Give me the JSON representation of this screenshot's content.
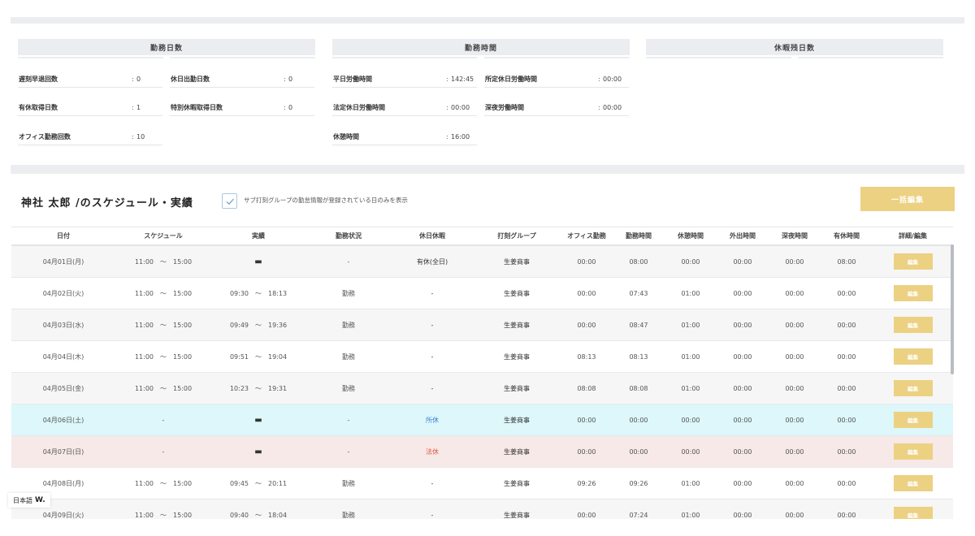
{
  "summary": {
    "work_days": {
      "title": "勤務日数",
      "items": [
        {
          "label": "遅刻早退回数",
          "value": "0"
        },
        {
          "label": "休日出勤日数",
          "value": "0"
        },
        {
          "label": "有休取得日数",
          "value": "1"
        },
        {
          "label": "特別休暇取得日数",
          "value": "0"
        },
        {
          "label": "オフィス勤務回数",
          "value": "10"
        }
      ]
    },
    "work_time": {
      "title": "勤務時間",
      "items": [
        {
          "label": "平日労働時間",
          "value": "142:45"
        },
        {
          "label": "所定休日労働時間",
          "value": "00:00"
        },
        {
          "label": "法定休日労働時間",
          "value": "00:00"
        },
        {
          "label": "深夜労働時間",
          "value": "00:00"
        },
        {
          "label": "休憩時間",
          "value": "16:00"
        }
      ]
    },
    "leave": {
      "title": "休暇残日数"
    }
  },
  "schedule": {
    "title": "神社 太郎 /のスケジュール・実績",
    "filter_label": "サブ打刻グループの勤怠情報が登録されている日のみを表示",
    "filter_checked": true,
    "bulk_edit_label": "一括編集"
  },
  "table": {
    "headers": [
      "日付",
      "スケジュール",
      "実績",
      "勤務状況",
      "休日休暇",
      "打刻グループ",
      "オフィス勤務",
      "勤務時間",
      "休憩時間",
      "外出時間",
      "深夜時間",
      "有休時間",
      "詳細/編集"
    ],
    "edit_label": "編集",
    "rows": [
      {
        "date": "04月01日(月)",
        "schedule": "11:00　～　15:00",
        "actual": "▬",
        "status": "-",
        "holiday": "有休(全日)",
        "group": "生姜商事",
        "office": "00:00",
        "work": "08:00",
        "break": "00:00",
        "out": "00:00",
        "night": "00:00",
        "paid": "08:00",
        "type": "odd"
      },
      {
        "date": "04月02日(火)",
        "schedule": "11:00　～　15:00",
        "actual": "09:30　～　18:13",
        "status": "勤務",
        "holiday": "-",
        "group": "生姜商事",
        "office": "00:00",
        "work": "07:43",
        "break": "01:00",
        "out": "00:00",
        "night": "00:00",
        "paid": "00:00",
        "type": "even"
      },
      {
        "date": "04月03日(水)",
        "schedule": "11:00　～　15:00",
        "actual": "09:49　～　19:36",
        "status": "勤務",
        "holiday": "-",
        "group": "生姜商事",
        "office": "00:00",
        "work": "08:47",
        "break": "01:00",
        "out": "00:00",
        "night": "00:00",
        "paid": "00:00",
        "type": "odd"
      },
      {
        "date": "04月04日(木)",
        "schedule": "11:00　～　15:00",
        "actual": "09:51　～　19:04",
        "status": "勤務",
        "holiday": "-",
        "group": "生姜商事",
        "office": "08:13",
        "work": "08:13",
        "break": "01:00",
        "out": "00:00",
        "night": "00:00",
        "paid": "00:00",
        "type": "even"
      },
      {
        "date": "04月05日(金)",
        "schedule": "11:00　～　15:00",
        "actual": "10:23　～　19:31",
        "status": "勤務",
        "holiday": "-",
        "group": "生姜商事",
        "office": "08:08",
        "work": "08:08",
        "break": "01:00",
        "out": "00:00",
        "night": "00:00",
        "paid": "00:00",
        "type": "odd"
      },
      {
        "date": "04月06日(土)",
        "schedule": "-",
        "actual": "▬",
        "status": "-",
        "holiday": "所休",
        "group": "生姜商事",
        "office": "00:00",
        "work": "00:00",
        "break": "00:00",
        "out": "00:00",
        "night": "00:00",
        "paid": "00:00",
        "type": "sat"
      },
      {
        "date": "04月07日(日)",
        "schedule": "-",
        "actual": "▬",
        "status": "-",
        "holiday": "法休",
        "group": "生姜商事",
        "office": "00:00",
        "work": "00:00",
        "break": "00:00",
        "out": "00:00",
        "night": "00:00",
        "paid": "00:00",
        "type": "sun"
      },
      {
        "date": "04月08日(月)",
        "schedule": "11:00　～　15:00",
        "actual": "09:45　～　20:11",
        "status": "勤務",
        "holiday": "-",
        "group": "生姜商事",
        "office": "09:26",
        "work": "09:26",
        "break": "01:00",
        "out": "00:00",
        "night": "00:00",
        "paid": "00:00",
        "type": "even"
      },
      {
        "date": "04月09日(火)",
        "schedule": "11:00　～　15:00",
        "actual": "09:40　～　18:04",
        "status": "勤務",
        "holiday": "-",
        "group": "生姜商事",
        "office": "00:00",
        "work": "07:24",
        "break": "01:00",
        "out": "00:00",
        "night": "00:00",
        "paid": "00:00",
        "type": "odd"
      }
    ]
  },
  "language": {
    "label": "日本語",
    "mark": "W."
  },
  "colors": {
    "accent": "#ecd182",
    "saturday_bg": "#ddf7fa",
    "sunday_bg": "#f6e9e7",
    "holiday_blue": "#3a84d6",
    "holiday_red": "#e0584d"
  }
}
